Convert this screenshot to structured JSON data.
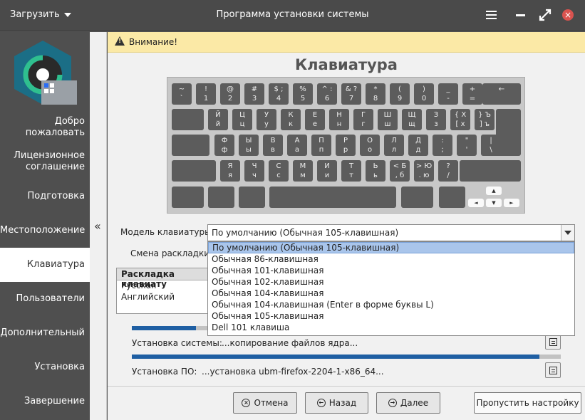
{
  "titlebar": {
    "menu_label": "Загрузить",
    "title": "Программа установки системы"
  },
  "sidebar": {
    "items": [
      {
        "label": "Добро пожаловать"
      },
      {
        "label": "Лицензионное соглашение"
      },
      {
        "label": "Подготовка"
      },
      {
        "label": "Местоположение"
      },
      {
        "label": "Клавиатура",
        "active": true
      },
      {
        "label": "Пользователи"
      },
      {
        "label": "Дополнительный"
      },
      {
        "label": "Установка"
      },
      {
        "label": "Завершение"
      }
    ],
    "collapse_glyph": "«"
  },
  "warning": {
    "text": "Внимание!"
  },
  "page": {
    "title": "Клавиатура"
  },
  "keyboard_rows": [
    [
      [
        "~",
        "`"
      ],
      [
        "!",
        "1"
      ],
      [
        "@",
        "2"
      ],
      [
        "#",
        "3"
      ],
      [
        "$ ;",
        "4"
      ],
      [
        "%",
        "5"
      ],
      [
        "^ :",
        "6"
      ],
      [
        "& ?",
        "7"
      ],
      [
        "*",
        "8"
      ],
      [
        "(",
        "9"
      ],
      [
        ")",
        "0"
      ],
      [
        "_",
        "-"
      ],
      [
        "+",
        "="
      ],
      [
        "←",
        ""
      ]
    ],
    [
      [
        "",
        ""
      ],
      [
        "Й",
        "й"
      ],
      [
        "Ц",
        "ц"
      ],
      [
        "У",
        "у"
      ],
      [
        "К",
        "к"
      ],
      [
        "Е",
        "е"
      ],
      [
        "Н",
        "н"
      ],
      [
        "Г",
        "г"
      ],
      [
        "Ш",
        "ш"
      ],
      [
        "Щ",
        "щ"
      ],
      [
        "З",
        "з"
      ],
      [
        "{ Х",
        "[ х"
      ],
      [
        "} Ъ",
        "] ъ"
      ],
      [
        "",
        ""
      ]
    ],
    [
      [
        "",
        ""
      ],
      [
        "Ф",
        "ф"
      ],
      [
        "Ы",
        "ы"
      ],
      [
        "В",
        "в"
      ],
      [
        "А",
        "а"
      ],
      [
        "П",
        "п"
      ],
      [
        "Р",
        "р"
      ],
      [
        "О",
        "о"
      ],
      [
        "Л",
        "л"
      ],
      [
        "Д",
        "д"
      ],
      [
        ":",
        ";"
      ],
      [
        "\"",
        "'"
      ],
      [
        "|",
        "\\"
      ]
    ],
    [
      [
        "",
        ""
      ],
      [
        "Я",
        "я"
      ],
      [
        "Ч",
        "ч"
      ],
      [
        "С",
        "с"
      ],
      [
        "М",
        "м"
      ],
      [
        "И",
        "и"
      ],
      [
        "Т",
        "т"
      ],
      [
        "Ь",
        "ь"
      ],
      [
        "< Б",
        ", б"
      ],
      [
        "> Ю",
        ". ю"
      ],
      [
        "?",
        "/"
      ],
      [
        "",
        ""
      ]
    ],
    [
      [
        "",
        ""
      ],
      [
        "",
        ""
      ],
      [
        "",
        ""
      ],
      [
        "",
        ""
      ],
      [
        "",
        ""
      ],
      [
        "",
        ""
      ],
      [
        "▲",
        ""
      ],
      [
        "◄",
        ""
      ],
      [
        "▼",
        ""
      ],
      [
        "►",
        ""
      ]
    ]
  ],
  "model": {
    "label": "Модель клавиатуры:",
    "value": "По умолчанию (Обычная 105-клавишная)",
    "options": [
      "По умолчанию (Обычная 105-клавишная)",
      "Обычная 86-клавишная",
      "Обычная 101-клавишная",
      "Обычная 102-клавишная",
      "Обычная 104-клавишная",
      "Обычная 104-клавишная (Enter в форме буквы L)",
      "Обычная 105-клавишная",
      "Dell 101 клавиша"
    ]
  },
  "switch": {
    "label": "Смена раскладки:"
  },
  "layouts": {
    "header": "Раскладка клавиату",
    "rows": [
      "Русская",
      "Английский"
    ]
  },
  "progress": {
    "top_fraction": 0.15,
    "system_label": "Установка системы:",
    "system_status": "...копирование файлов ядра...",
    "system_fraction": 0.95,
    "software_label": "Установка ПО:",
    "software_status": "...установка ubm-firefox-2204-1-x86_64..."
  },
  "buttons": {
    "cancel": "Отмена",
    "back": "Назад",
    "next": "Далее",
    "skip": "Пропустить настройку"
  }
}
